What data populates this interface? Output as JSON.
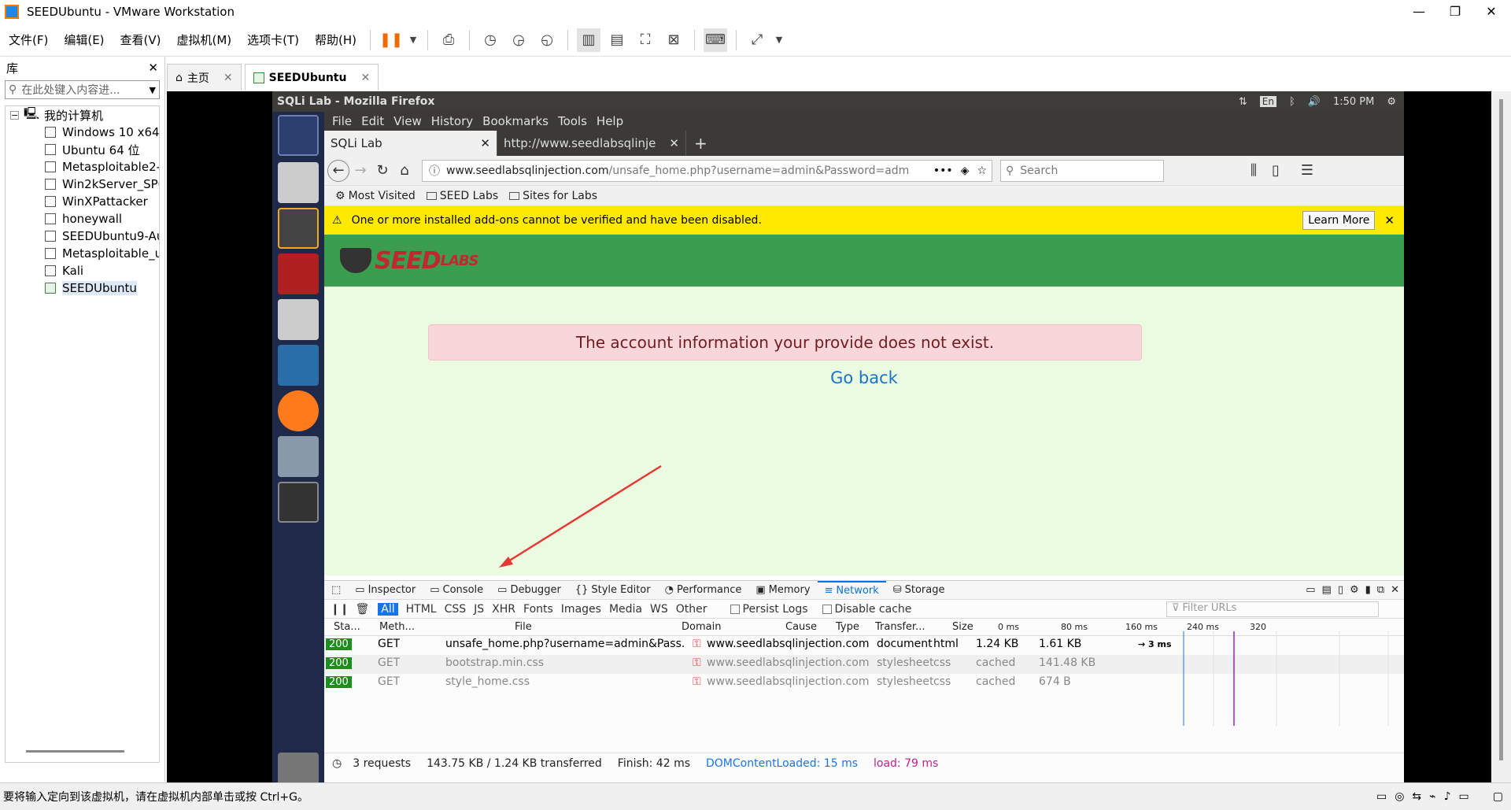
{
  "window": {
    "title": "SEEDUbuntu - VMware Workstation"
  },
  "menubar": {
    "items": [
      "文件(F)",
      "编辑(E)",
      "查看(V)",
      "虚拟机(M)",
      "选项卡(T)",
      "帮助(H)"
    ]
  },
  "library": {
    "title": "库",
    "search_placeholder": "在此处键入内容进...",
    "root": "我的计算机",
    "vms": [
      "Windows 10 x64",
      "Ubuntu 64 位",
      "Metasploitable2-",
      "Win2kServer_SP0",
      "WinXPattacker",
      "honeywall",
      "SEEDUbuntu9-Au",
      "Metasploitable_u",
      "Kali",
      "SEEDUbuntu"
    ],
    "selected": "SEEDUbuntu"
  },
  "vm_tabs": [
    {
      "label": "主页"
    },
    {
      "label": "SEEDUbuntu"
    }
  ],
  "ubuntu_panel": {
    "title": "SQLi Lab - Mozilla Firefox",
    "lang": "En",
    "time": "1:50 PM"
  },
  "firefox": {
    "menus": [
      "File",
      "Edit",
      "View",
      "History",
      "Bookmarks",
      "Tools",
      "Help"
    ],
    "tabs": [
      "SQLi Lab",
      "http://www.seedlabsqlinje"
    ],
    "url_domain": "www.seedlabsqlinjection.com",
    "url_rest": "/unsafe_home.php?username=admin&Password=adm",
    "search_placeholder": "Search",
    "bookmarks": [
      "Most Visited",
      "SEED Labs",
      "Sites for Labs"
    ],
    "notice": "One or more installed add-ons cannot be verified and have been disabled.",
    "notice_button": "Learn More"
  },
  "page": {
    "logo_main": "SEED",
    "logo_sub": "LABS",
    "alert": "The account information your provide does not exist.",
    "goback": "Go back"
  },
  "devtools": {
    "tabs": [
      "Inspector",
      "Console",
      "Debugger",
      "Style Editor",
      "Performance",
      "Memory",
      "Network",
      "Storage"
    ],
    "active_tab": "Network",
    "filters": [
      "All",
      "HTML",
      "CSS",
      "JS",
      "XHR",
      "Fonts",
      "Images",
      "Media",
      "WS",
      "Other"
    ],
    "persist_logs": "Persist Logs",
    "disable_cache": "Disable cache",
    "filter_urls": "Filter URLs",
    "columns": [
      "Sta...",
      "Meth...",
      "File",
      "Domain",
      "Cause",
      "Type",
      "Transfer...",
      "Size"
    ],
    "timeline_ticks": [
      "0 ms",
      "80 ms",
      "160 ms",
      "240 ms",
      "320"
    ],
    "timing_label": "→ 3 ms",
    "requests": [
      {
        "status": "200",
        "method": "GET",
        "file": "unsafe_home.php?username=admin&Pass...",
        "domain": "www.seedlabsqlinjection.com",
        "cause": "document",
        "type": "html",
        "transferred": "1.24 KB",
        "size": "1.61 KB"
      },
      {
        "status": "200",
        "method": "GET",
        "file": "bootstrap.min.css",
        "domain": "www.seedlabsqlinjection.com",
        "cause": "stylesheet",
        "type": "css",
        "transferred": "cached",
        "size": "141.48 KB"
      },
      {
        "status": "200",
        "method": "GET",
        "file": "style_home.css",
        "domain": "www.seedlabsqlinjection.com",
        "cause": "stylesheet",
        "type": "css",
        "transferred": "cached",
        "size": "674 B"
      }
    ],
    "summary": {
      "requests": "3 requests",
      "transferred": "143.75 KB / 1.24 KB transferred",
      "finish": "Finish: 42 ms",
      "domcontent": "DOMContentLoaded: 15 ms",
      "load": "load: 79 ms"
    }
  },
  "status_bar": {
    "text": "要将输入定向到该虚拟机，请在虚拟机内部单击或按 Ctrl+G。"
  },
  "colors": {
    "accent": "#1b74e4",
    "seed_green": "#3b9e4e",
    "alert_bg": "#f8d7da",
    "notice": "#ffe900"
  }
}
